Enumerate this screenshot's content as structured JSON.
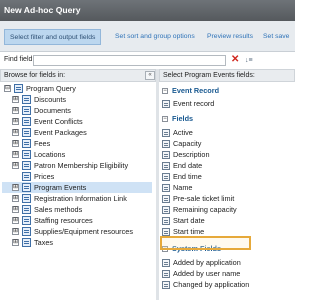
{
  "window": {
    "title": "New Ad-hoc Query"
  },
  "tabs": [
    {
      "label": "Select filter and output fields",
      "active": true
    },
    {
      "label": "Set sort and group options",
      "active": false
    },
    {
      "label": "Preview results",
      "active": false
    },
    {
      "label": "Set save",
      "active": false
    }
  ],
  "find": {
    "label": "Find field:",
    "value": "",
    "placeholder": ""
  },
  "left_panel": {
    "header": "Browse for fields in:",
    "collapse_glyph": "«",
    "tree": [
      {
        "label": "Program Query",
        "expander": "⊟",
        "depth": 0
      },
      {
        "label": "Discounts",
        "expander": "⊞",
        "depth": 1
      },
      {
        "label": "Documents",
        "expander": "⊞",
        "depth": 1
      },
      {
        "label": "Event Conflicts",
        "expander": "⊞",
        "depth": 1
      },
      {
        "label": "Event Packages",
        "expander": "⊞",
        "depth": 1
      },
      {
        "label": "Fees",
        "expander": "⊞",
        "depth": 1
      },
      {
        "label": "Locations",
        "expander": "⊞",
        "depth": 1
      },
      {
        "label": "Patron Membership Eligibility",
        "expander": "⊞",
        "depth": 1
      },
      {
        "label": "Prices",
        "expander": "",
        "depth": 1
      },
      {
        "label": "Program Events",
        "expander": "⊞",
        "depth": 1,
        "selected": true
      },
      {
        "label": "Registration Information Link",
        "expander": "⊞",
        "depth": 1
      },
      {
        "label": "Sales methods",
        "expander": "⊞",
        "depth": 1
      },
      {
        "label": "Staffing resources",
        "expander": "⊞",
        "depth": 1
      },
      {
        "label": "Supplies/Equipment resources",
        "expander": "⊞",
        "depth": 1
      },
      {
        "label": "Taxes",
        "expander": "⊞",
        "depth": 1
      }
    ]
  },
  "right_panel": {
    "header": "Select Program Events fields:",
    "sections": [
      {
        "title": "Event Record",
        "fields": [
          "Event record"
        ]
      },
      {
        "title": "Fields",
        "fields": [
          "Active",
          "Capacity",
          "Description",
          "End date",
          "End time",
          "Name",
          "Pre-sale ticket limit",
          "Remaining capacity",
          "Start date",
          "Start time"
        ]
      },
      {
        "title": "System Fields",
        "fields": [
          "Added by application",
          "Added by user name",
          "Changed by application"
        ]
      }
    ],
    "highlighted_field": "Remaining capacity"
  },
  "colors": {
    "accent": "#2f73b8",
    "highlight": "#e6a93a",
    "selected_row": "#cfe2f5"
  }
}
